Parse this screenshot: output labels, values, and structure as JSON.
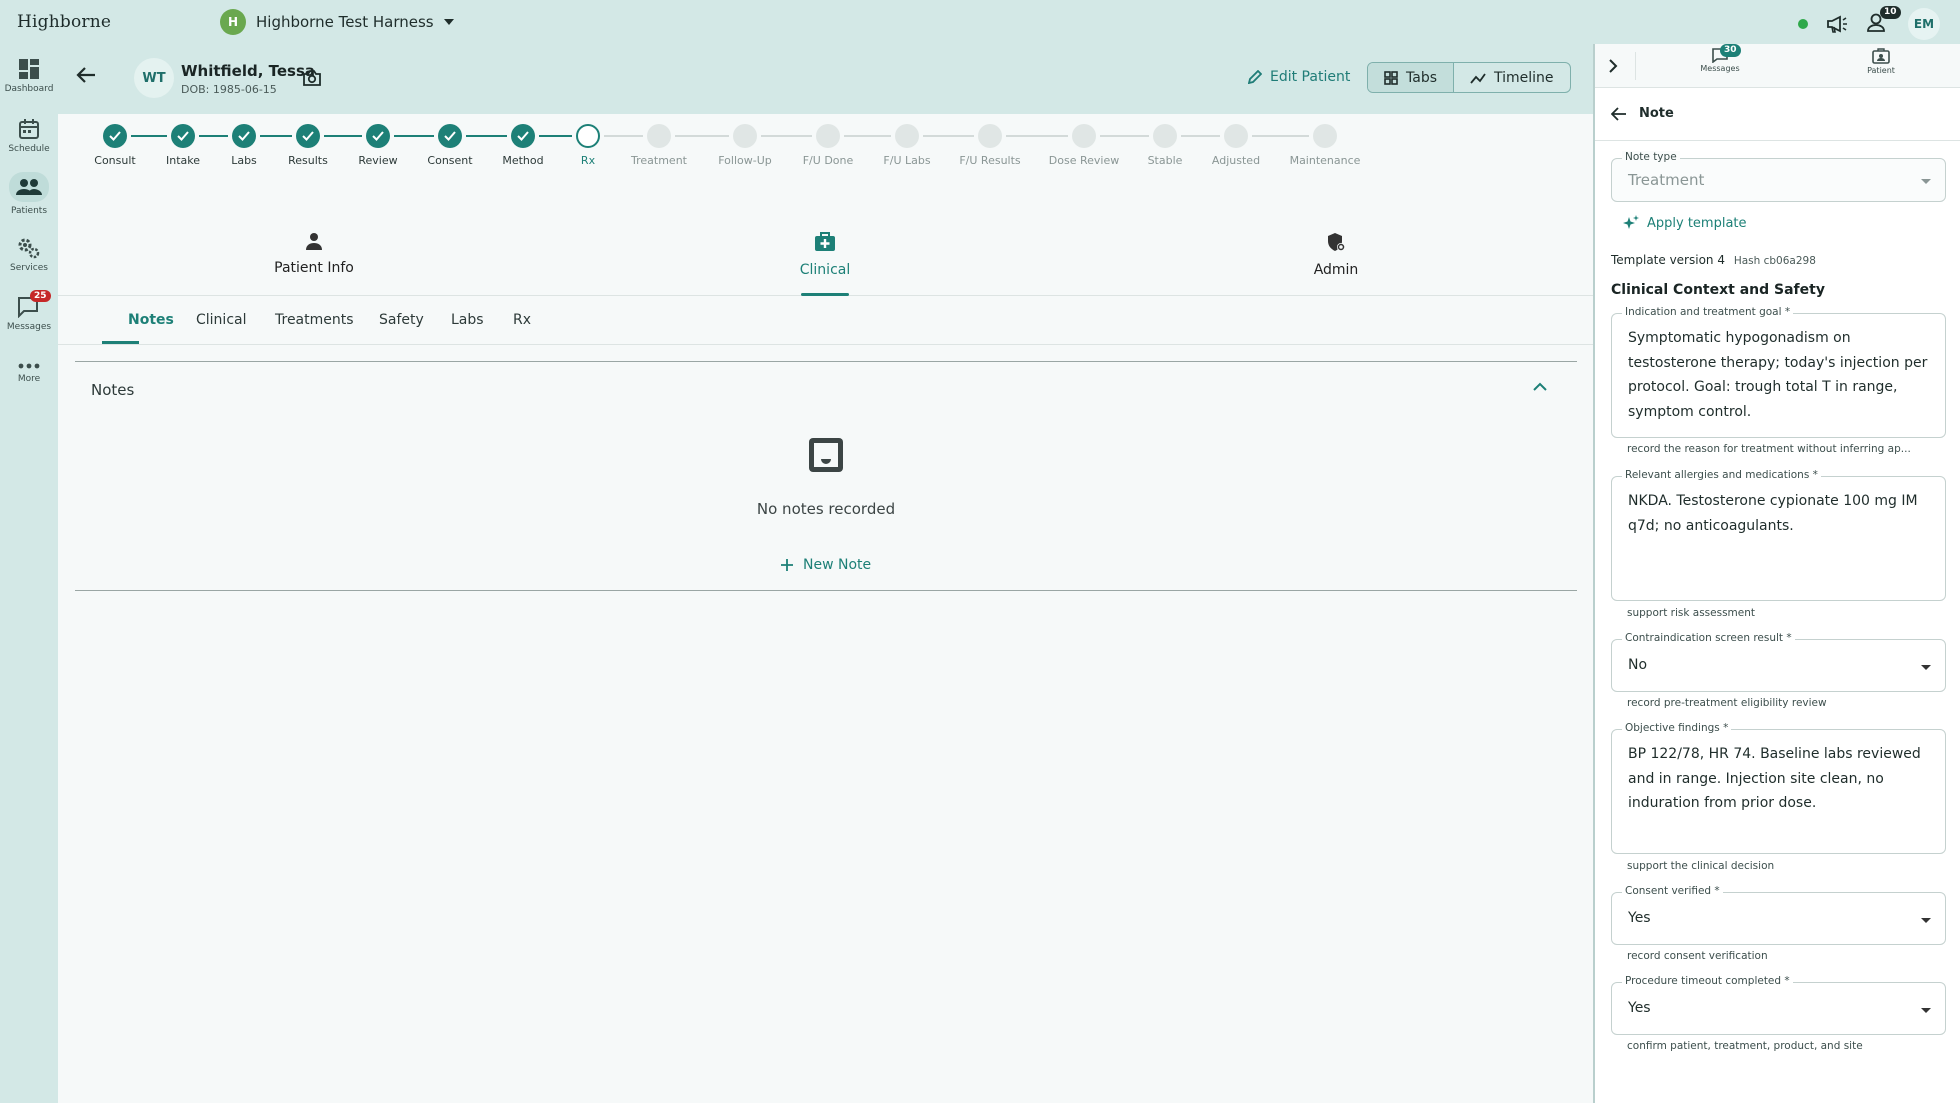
{
  "app": {
    "brand": "Highborne",
    "workspace_initial": "H",
    "workspace": "Highborne Test Harness",
    "notif_count": "10",
    "user_initials": "EM"
  },
  "nav": [
    {
      "label": "Dashboard",
      "icon": "dashboard-icon"
    },
    {
      "label": "Schedule",
      "icon": "calendar-icon"
    },
    {
      "label": "Patients",
      "icon": "people-icon"
    },
    {
      "label": "Services",
      "icon": "gears-icon"
    },
    {
      "label": "Messages",
      "icon": "chat-icon",
      "badge": "25"
    },
    {
      "label": "More",
      "icon": "more-icon"
    }
  ],
  "patient": {
    "initials": "WT",
    "name": "Whitfield, Tessa",
    "dob": "DOB: 1985-06-15",
    "edit_label": "Edit Patient",
    "view_tabs": "Tabs",
    "view_timeline": "Timeline"
  },
  "steps": [
    {
      "label": "Consult",
      "state": "done"
    },
    {
      "label": "Intake",
      "state": "done"
    },
    {
      "label": "Labs",
      "state": "done"
    },
    {
      "label": "Results",
      "state": "done"
    },
    {
      "label": "Review",
      "state": "done"
    },
    {
      "label": "Consent",
      "state": "done"
    },
    {
      "label": "Method",
      "state": "done"
    },
    {
      "label": "Rx",
      "state": "current"
    },
    {
      "label": "Treatment",
      "state": "todo"
    },
    {
      "label": "Follow-Up",
      "state": "todo"
    },
    {
      "label": "F/U Done",
      "state": "todo"
    },
    {
      "label": "F/U Labs",
      "state": "todo"
    },
    {
      "label": "F/U Results",
      "state": "todo"
    },
    {
      "label": "Dose Review",
      "state": "todo"
    },
    {
      "label": "Stable",
      "state": "todo"
    },
    {
      "label": "Adjusted",
      "state": "todo"
    },
    {
      "label": "Maintenance",
      "state": "todo"
    }
  ],
  "main_tabs": [
    {
      "label": "Patient Info"
    },
    {
      "label": "Clinical"
    },
    {
      "label": "Admin"
    }
  ],
  "sub_tabs": [
    {
      "label": "Notes"
    },
    {
      "label": "Clinical"
    },
    {
      "label": "Treatments"
    },
    {
      "label": "Safety"
    },
    {
      "label": "Labs"
    },
    {
      "label": "Rx"
    }
  ],
  "notes": {
    "title": "Notes",
    "empty": "No notes recorded",
    "new_note": "New Note"
  },
  "panel": {
    "messages_label": "Messages",
    "messages_count": "30",
    "patient_label": "Patient",
    "note_title": "Note",
    "note_type_label": "Note type",
    "note_type_value": "Treatment",
    "apply_template": "Apply template",
    "template_version": "Template version 4",
    "template_hash": "Hash cb06a298",
    "section_title": "Clinical Context and Safety",
    "fields": [
      {
        "label": "Indication and treatment goal *",
        "value": "Symptomatic hypogonadism on testosterone therapy; today's injection per protocol. Goal: trough total T in range, symptom control.",
        "help": "record the reason for treatment without inferring ap..."
      },
      {
        "label": "Relevant allergies and medications *",
        "value": "NKDA. Testosterone cypionate 100 mg IM q7d; no anticoagulants.",
        "help": "support risk assessment"
      },
      {
        "label": "Contraindication screen result *",
        "value": "No",
        "help": "record pre-treatment eligibility review"
      },
      {
        "label": "Objective findings *",
        "value": "BP 122/78, HR 74. Baseline labs reviewed and in range. Injection site clean, no induration from prior dose.",
        "help": "support the clinical decision"
      },
      {
        "label": "Consent verified *",
        "value": "Yes",
        "help": "record consent verification"
      },
      {
        "label": "Procedure timeout completed *",
        "value": "Yes",
        "help": "confirm patient, treatment, product, and site"
      }
    ]
  },
  "colors": {
    "accent": "#1d8077",
    "sidebar_bg": "#d3e8e6",
    "danger_badge": "#c62828",
    "status_online": "#2ea84a"
  }
}
